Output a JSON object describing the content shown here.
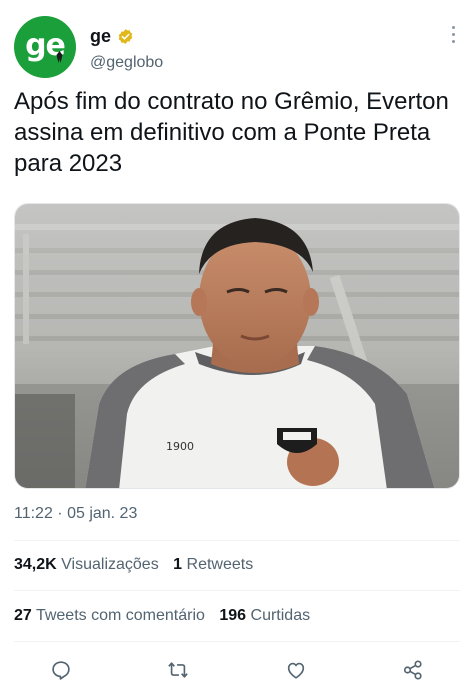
{
  "account": {
    "display_name": "ge",
    "handle": "@geglobo",
    "avatar_text": "ge",
    "verified": true,
    "avatar_color": "#1a9f3a",
    "verified_color": "#e2b719"
  },
  "tweet": {
    "text": "Após fim do contrato no Grêmio, Everton assina em definitivo com a Ponte Preta para 2023",
    "timestamp": "11:22 · 05 jan. 23"
  },
  "stats": {
    "views_count": "34,2K",
    "views_label": "Visualizações",
    "retweets_count": "1",
    "retweets_label": "Retweets",
    "quotes_count": "27",
    "quotes_label": "Tweets com comentário",
    "likes_count": "196",
    "likes_label": "Curtidas"
  },
  "actions": {
    "icons": [
      "reply-icon",
      "retweet-icon",
      "like-icon",
      "share-icon"
    ],
    "icon_color": "#536471"
  },
  "media": {
    "alt": "Everton em treino com camisa da Ponte Preta",
    "jersey_badge": "1900"
  }
}
